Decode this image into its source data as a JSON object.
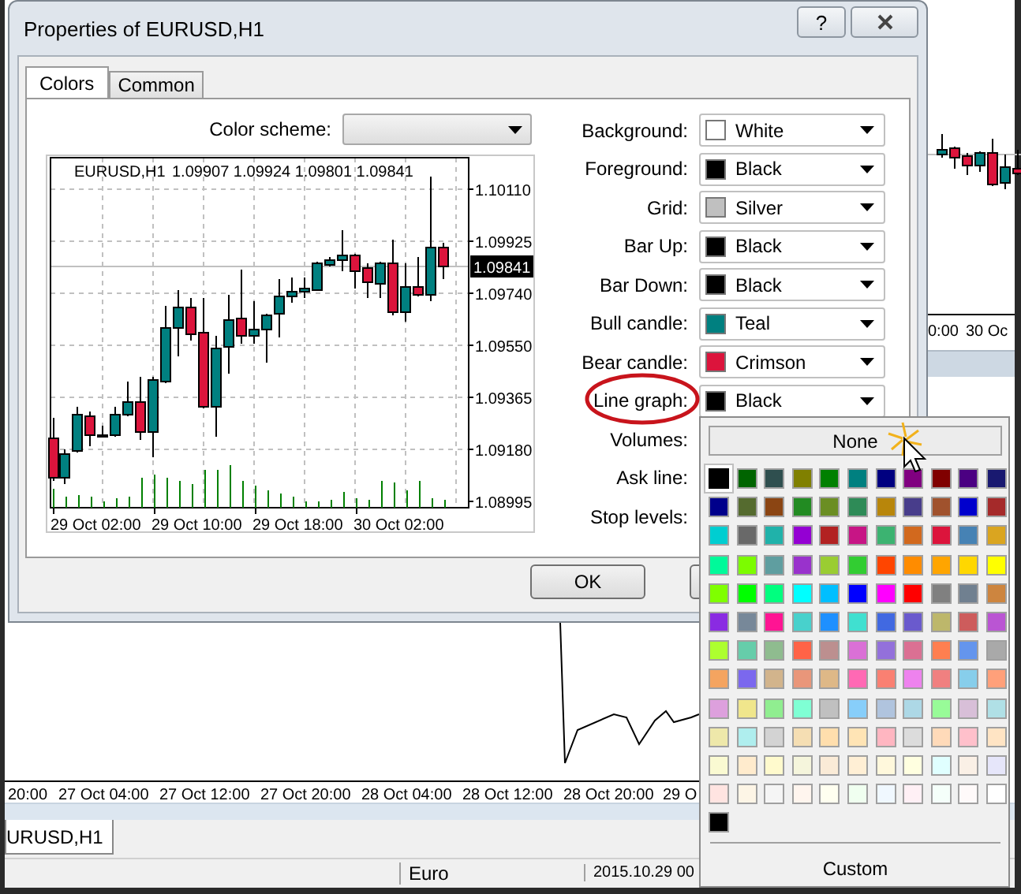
{
  "background_chart": {
    "time_labels": [
      "20:00",
      "27 Oct 04:00",
      "27 Oct 12:00",
      "27 Oct 20:00",
      "28 Oct 04:00",
      "28 Oct 12:00",
      "28 Oct 20:00",
      "29 O"
    ],
    "right_time_labels": [
      "0:00",
      "30 Oc"
    ],
    "tabs": [
      {
        "label": "URUSD,H1",
        "selected": true
      }
    ],
    "status_bar": [
      "Euro",
      "2015.10.29 00"
    ]
  },
  "dialog": {
    "title": "Properties of EURUSD,H1",
    "help_label": "?",
    "tabs": [
      {
        "label": "Colors",
        "selected": true
      },
      {
        "label": "Common",
        "selected": false
      }
    ],
    "color_scheme": {
      "label": "Color scheme:"
    },
    "chart": {
      "symbol": "EURUSD,H1",
      "ohlc": "1.09907 1.09924 1.09801 1.09841",
      "price_labels": [
        "1.10110",
        "1.09925",
        "1.09740",
        "1.09550",
        "1.09365",
        "1.09180",
        "1.08995"
      ],
      "current_price": "1.09841",
      "time_labels": [
        "29 Oct 02:00",
        "29 Oct 10:00",
        "29 Oct 18:00",
        "30 Oct 02:00"
      ]
    },
    "color_rows": [
      {
        "label": "Background:",
        "value": "White",
        "color": "#ffffff"
      },
      {
        "label": "Foreground:",
        "value": "Black",
        "color": "#000000"
      },
      {
        "label": "Grid:",
        "value": "Silver",
        "color": "#c0c0c0"
      },
      {
        "label": "Bar Up:",
        "value": "Black",
        "color": "#000000"
      },
      {
        "label": "Bar Down:",
        "value": "Black",
        "color": "#000000"
      },
      {
        "label": "Bull candle:",
        "value": "Teal",
        "color": "#008080"
      },
      {
        "label": "Bear candle:",
        "value": "Crimson",
        "color": "#dc143c"
      },
      {
        "label": "Line graph:",
        "value": "Black",
        "color": "#000000"
      },
      {
        "label": "Volumes:"
      },
      {
        "label": "Ask line:"
      },
      {
        "label": "Stop levels:"
      }
    ],
    "buttons": [
      {
        "label": "OK"
      }
    ]
  },
  "palette": {
    "none_label": "None",
    "custom_label": "Custom",
    "swatches": [
      {
        "color": "#000000",
        "selected": true
      },
      {
        "color": "#006400",
        "selected": false
      },
      {
        "color": "#2f4f4f",
        "selected": false
      },
      {
        "color": "#808000",
        "selected": false
      },
      {
        "color": "#008000",
        "selected": false
      },
      {
        "color": "#008080",
        "selected": false
      },
      {
        "color": "#000080",
        "selected": false
      },
      {
        "color": "#800080",
        "selected": false
      },
      {
        "color": "#800000",
        "selected": false
      },
      {
        "color": "#4b0082",
        "selected": false
      },
      {
        "color": "#191970",
        "selected": false
      },
      {
        "color": "#00008b",
        "selected": false
      },
      {
        "color": "#556b2f",
        "selected": false
      },
      {
        "color": "#8b4513",
        "selected": false
      },
      {
        "color": "#228b22",
        "selected": false
      },
      {
        "color": "#6b8e23",
        "selected": false
      },
      {
        "color": "#2e8b57",
        "selected": false
      },
      {
        "color": "#b8860b",
        "selected": false
      },
      {
        "color": "#483d8b",
        "selected": false
      },
      {
        "color": "#a0522d",
        "selected": false
      },
      {
        "color": "#0000cd",
        "selected": false
      },
      {
        "color": "#a52a2a",
        "selected": false
      },
      {
        "color": "#00ced1",
        "selected": false
      },
      {
        "color": "#696969",
        "selected": false
      },
      {
        "color": "#20b2aa",
        "selected": false
      },
      {
        "color": "#9400d3",
        "selected": false
      },
      {
        "color": "#b22222",
        "selected": false
      },
      {
        "color": "#c71585",
        "selected": false
      },
      {
        "color": "#3cb371",
        "selected": false
      },
      {
        "color": "#d2691e",
        "selected": false
      },
      {
        "color": "#dc143c",
        "selected": false
      },
      {
        "color": "#4682b4",
        "selected": false
      },
      {
        "color": "#daa520",
        "selected": false
      },
      {
        "color": "#00fa9a",
        "selected": false
      },
      {
        "color": "#7cfc00",
        "selected": false
      },
      {
        "color": "#5f9ea0",
        "selected": false
      },
      {
        "color": "#9932cc",
        "selected": false
      },
      {
        "color": "#9acd32",
        "selected": false
      },
      {
        "color": "#32cd32",
        "selected": false
      },
      {
        "color": "#ff4500",
        "selected": false
      },
      {
        "color": "#ff8c00",
        "selected": false
      },
      {
        "color": "#ffa500",
        "selected": false
      },
      {
        "color": "#ffd700",
        "selected": false
      },
      {
        "color": "#ffff00",
        "selected": false
      },
      {
        "color": "#7fff00",
        "selected": false
      },
      {
        "color": "#00ff00",
        "selected": false
      },
      {
        "color": "#00ff7f",
        "selected": false
      },
      {
        "color": "#00ffff",
        "selected": false
      },
      {
        "color": "#00bfff",
        "selected": false
      },
      {
        "color": "#0000ff",
        "selected": false
      },
      {
        "color": "#ff00ff",
        "selected": false
      },
      {
        "color": "#ff0000",
        "selected": false
      },
      {
        "color": "#808080",
        "selected": false
      },
      {
        "color": "#708090",
        "selected": false
      },
      {
        "color": "#cd853f",
        "selected": false
      },
      {
        "color": "#8a2be2",
        "selected": false
      },
      {
        "color": "#778899",
        "selected": false
      },
      {
        "color": "#ff1493",
        "selected": false
      },
      {
        "color": "#48d1cc",
        "selected": false
      },
      {
        "color": "#1e90ff",
        "selected": false
      },
      {
        "color": "#40e0d0",
        "selected": false
      },
      {
        "color": "#4169e1",
        "selected": false
      },
      {
        "color": "#6a5acd",
        "selected": false
      },
      {
        "color": "#bdb76b",
        "selected": false
      },
      {
        "color": "#cd5c5c",
        "selected": false
      },
      {
        "color": "#ba55d3",
        "selected": false
      },
      {
        "color": "#adff2f",
        "selected": false
      },
      {
        "color": "#66cdaa",
        "selected": false
      },
      {
        "color": "#8fbc8f",
        "selected": false
      },
      {
        "color": "#ff6347",
        "selected": false
      },
      {
        "color": "#bc8f8f",
        "selected": false
      },
      {
        "color": "#da70d6",
        "selected": false
      },
      {
        "color": "#9370db",
        "selected": false
      },
      {
        "color": "#db7093",
        "selected": false
      },
      {
        "color": "#ff7f50",
        "selected": false
      },
      {
        "color": "#6495ed",
        "selected": false
      },
      {
        "color": "#a9a9a9",
        "selected": false
      },
      {
        "color": "#f4a460",
        "selected": false
      },
      {
        "color": "#7b68ee",
        "selected": false
      },
      {
        "color": "#d2b48c",
        "selected": false
      },
      {
        "color": "#e9967a",
        "selected": false
      },
      {
        "color": "#deb887",
        "selected": false
      },
      {
        "color": "#ff69b4",
        "selected": false
      },
      {
        "color": "#fa8072",
        "selected": false
      },
      {
        "color": "#ee82ee",
        "selected": false
      },
      {
        "color": "#f08080",
        "selected": false
      },
      {
        "color": "#87ceeb",
        "selected": false
      },
      {
        "color": "#ffa07a",
        "selected": false
      },
      {
        "color": "#dda0dd",
        "selected": false
      },
      {
        "color": "#f0e68c",
        "selected": false
      },
      {
        "color": "#90ee90",
        "selected": false
      },
      {
        "color": "#7fffd4",
        "selected": false
      },
      {
        "color": "#c0c0c0",
        "selected": false
      },
      {
        "color": "#87cefa",
        "selected": false
      },
      {
        "color": "#b0c4de",
        "selected": false
      },
      {
        "color": "#add8e6",
        "selected": false
      },
      {
        "color": "#98fb98",
        "selected": false
      },
      {
        "color": "#d8bfd8",
        "selected": false
      },
      {
        "color": "#b0e0e6",
        "selected": false
      },
      {
        "color": "#eee8aa",
        "selected": false
      },
      {
        "color": "#afeeee",
        "selected": false
      },
      {
        "color": "#d3d3d3",
        "selected": false
      },
      {
        "color": "#f5deb3",
        "selected": false
      },
      {
        "color": "#ffdead",
        "selected": false
      },
      {
        "color": "#ffe4b5",
        "selected": false
      },
      {
        "color": "#ffb6c1",
        "selected": false
      },
      {
        "color": "#dcdcdc",
        "selected": false
      },
      {
        "color": "#ffdab9",
        "selected": false
      },
      {
        "color": "#ffc0cb",
        "selected": false
      },
      {
        "color": "#ffe4c4",
        "selected": false
      },
      {
        "color": "#fafad2",
        "selected": false
      },
      {
        "color": "#ffebcd",
        "selected": false
      },
      {
        "color": "#fffacd",
        "selected": false
      },
      {
        "color": "#f5f5dc",
        "selected": false
      },
      {
        "color": "#faebd7",
        "selected": false
      },
      {
        "color": "#ffefd5",
        "selected": false
      },
      {
        "color": "#fff8dc",
        "selected": false
      },
      {
        "color": "#ffffe0",
        "selected": false
      },
      {
        "color": "#e0ffff",
        "selected": false
      },
      {
        "color": "#faf0e6",
        "selected": false
      },
      {
        "color": "#e6e6fa",
        "selected": false
      },
      {
        "color": "#ffe4e1",
        "selected": false
      },
      {
        "color": "#fdf5e6",
        "selected": false
      },
      {
        "color": "#f5f5f5",
        "selected": false
      },
      {
        "color": "#fff5ee",
        "selected": false
      },
      {
        "color": "#fffff0",
        "selected": false
      },
      {
        "color": "#f0fff0",
        "selected": false
      },
      {
        "color": "#f0f8ff",
        "selected": false
      },
      {
        "color": "#fff0f5",
        "selected": false
      },
      {
        "color": "#f5fffa",
        "selected": false
      },
      {
        "color": "#fffafa",
        "selected": false
      },
      {
        "color": "#ffffff",
        "selected": false
      },
      {
        "color": "#000000",
        "selected": false
      }
    ]
  }
}
